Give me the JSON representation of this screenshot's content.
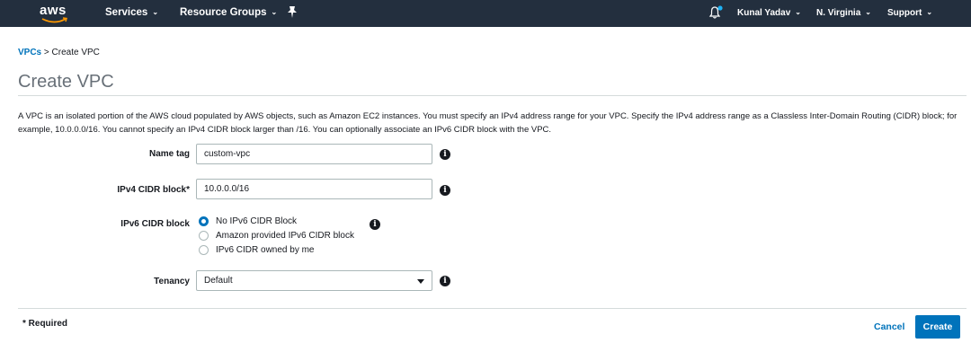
{
  "topnav": {
    "logo": "aws",
    "services": "Services",
    "resource_groups": "Resource Groups",
    "user": "Kunal Yadav",
    "region": "N. Virginia",
    "support": "Support"
  },
  "breadcrumb": {
    "parent": "VPCs",
    "separator": " > ",
    "current": "Create VPC"
  },
  "page": {
    "title": "Create VPC",
    "description": "A VPC is an isolated portion of the AWS cloud populated by AWS objects, such as Amazon EC2 instances. You must specify an IPv4 address range for your VPC. Specify the IPv4 address range as a Classless Inter-Domain Routing (CIDR) block; for example, 10.0.0.0/16. You cannot specify an IPv4 CIDR block larger than /16. You can optionally associate an IPv6 CIDR block with the VPC."
  },
  "form": {
    "name_tag": {
      "label": "Name tag",
      "value": "custom-vpc"
    },
    "ipv4_cidr": {
      "label": "IPv4 CIDR block*",
      "value": "10.0.0.0/16"
    },
    "ipv6_cidr": {
      "label": "IPv6 CIDR block",
      "options": [
        "No IPv6 CIDR Block",
        "Amazon provided IPv6 CIDR block",
        "IPv6 CIDR owned by me"
      ],
      "selected_index": 0
    },
    "tenancy": {
      "label": "Tenancy",
      "value": "Default"
    },
    "info_glyph": "i"
  },
  "footer": {
    "required_note": "* Required",
    "cancel": "Cancel",
    "create": "Create"
  },
  "colors": {
    "nav_bg": "#232f3e",
    "link": "#0073bb",
    "primary_button": "#0073bb",
    "notification_dot": "#1eb2f4"
  }
}
